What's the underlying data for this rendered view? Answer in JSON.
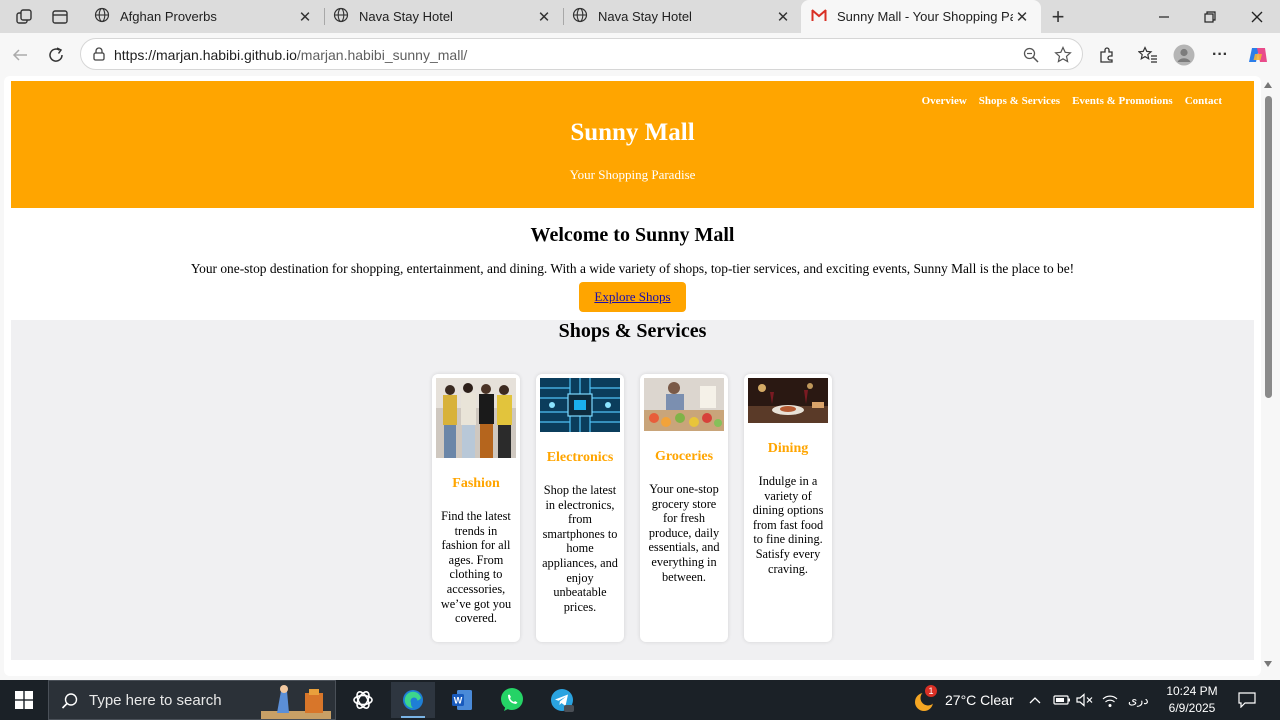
{
  "browser": {
    "tabs": [
      {
        "title": "Afghan Proverbs",
        "icon": "globe-icon",
        "active": false
      },
      {
        "title": "Nava Stay Hotel",
        "icon": "globe-icon",
        "active": false
      },
      {
        "title": "Nava Stay Hotel",
        "icon": "globe-icon",
        "active": false
      },
      {
        "title": "Sunny Mall - Your Shopping Parad",
        "icon": "gmail-icon",
        "active": true
      }
    ],
    "url_host": "https://marjan.habibi.github.io",
    "url_path": "/marjan.habibi_sunny_mall/"
  },
  "site": {
    "nav": [
      "Overview",
      "Shops & Services",
      "Events & Promotions",
      "Contact"
    ],
    "title": "Sunny Mall",
    "tagline": "Your Shopping Paradise",
    "accent_color": "#ffa500"
  },
  "welcome": {
    "title": "Welcome to Sunny Mall",
    "text": "Your one-stop destination for shopping, entertainment, and dining. With a wide variety of shops, top-tier services, and exciting events, Sunny Mall is the place to be!",
    "cta": "Explore Shops"
  },
  "services": {
    "title": "Shops & Services",
    "cards": [
      {
        "name": "Fashion",
        "desc": "Find the latest trends in fashion for all ages. From clothing to accessories, we’ve got you covered.",
        "image": "fashion-photo"
      },
      {
        "name": "Electronics",
        "desc": "Shop the latest in electronics, from smartphones to home appliances, and enjoy unbeatable prices.",
        "image": "electronics-photo"
      },
      {
        "name": "Groceries",
        "desc": "Your one-stop grocery store for fresh produce, daily essentials, and everything in between.",
        "image": "groceries-photo"
      },
      {
        "name": "Dining",
        "desc": "Indulge in a variety of dining options from fast food to fine dining. Satisfy every craving.",
        "image": "dining-photo"
      }
    ]
  },
  "taskbar": {
    "search_placeholder": "Type here to search",
    "weather": "27°C  Clear",
    "weather_badge": "1",
    "language": "دری",
    "time": "10:24 PM",
    "date": "6/9/2025"
  }
}
